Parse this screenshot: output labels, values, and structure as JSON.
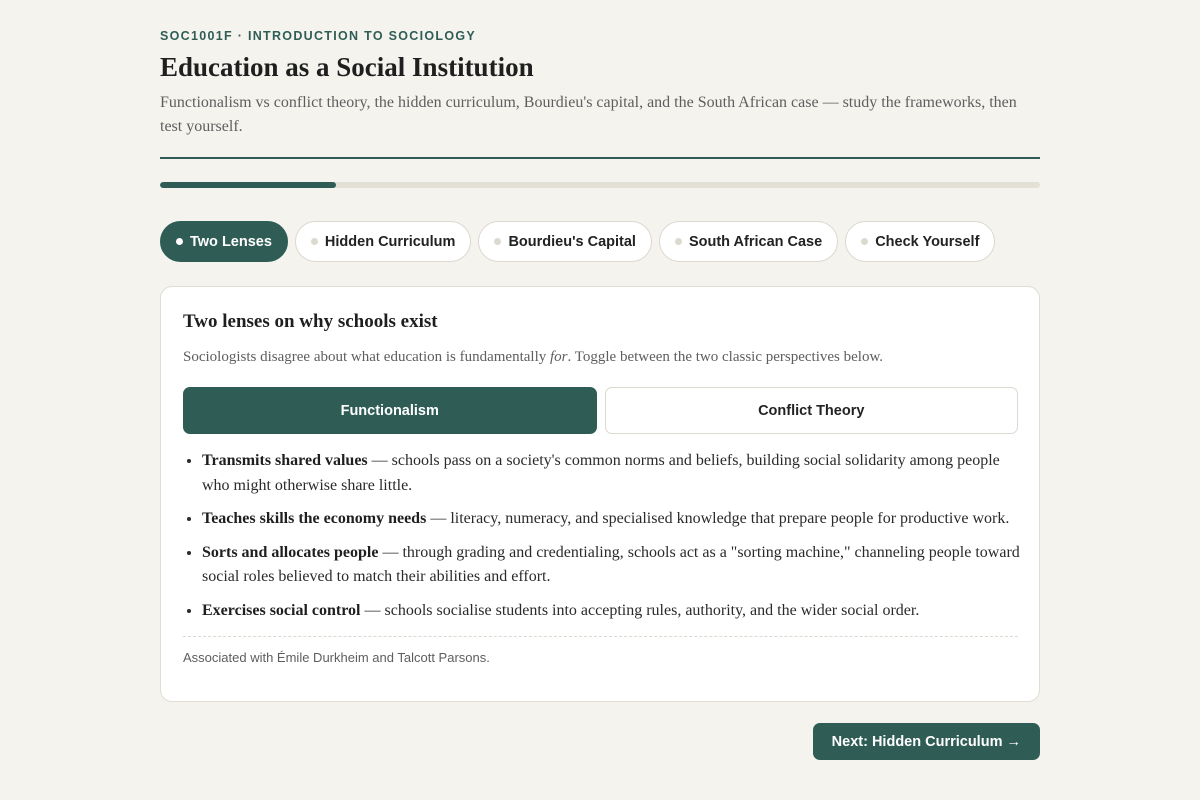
{
  "course": {
    "label": "SOC1001F · INTRODUCTION TO SOCIOLOGY"
  },
  "header": {
    "title": "Education as a Social Institution",
    "subtitle": "Functionalism vs conflict theory, the hidden curriculum, Bourdieu's capital, and the South African case — study the frameworks, then test yourself."
  },
  "progress": {
    "fraction": 0.2
  },
  "tabs": [
    {
      "label": "Two Lenses",
      "active": true
    },
    {
      "label": "Hidden Curriculum",
      "active": false
    },
    {
      "label": "Bourdieu's Capital",
      "active": false
    },
    {
      "label": "South African Case",
      "active": false
    },
    {
      "label": "Check Yourself",
      "active": false
    }
  ],
  "card": {
    "title": "Two lenses on why schools exist",
    "intro_before": "Sociologists disagree about what education is fundamentally ",
    "intro_em": "for",
    "intro_after": ". Toggle between the two classic perspectives below.",
    "toggle": [
      {
        "label": "Functionalism",
        "active": true
      },
      {
        "label": "Conflict Theory",
        "active": false
      }
    ],
    "points": [
      {
        "term": "Transmits shared values",
        "text": " — schools pass on a society's common norms and beliefs, building social solidarity among people who might otherwise share little."
      },
      {
        "term": "Teaches skills the economy needs",
        "text": " — literacy, numeracy, and specialised knowledge that prepare people for productive work."
      },
      {
        "term": "Sorts and allocates people",
        "text": " — through grading and credentialing, schools act as a \"sorting machine,\" channeling people toward social roles believed to match their abilities and effort."
      },
      {
        "term": "Exercises social control",
        "text": " — schools socialise students into accepting rules, authority, and the wider social order."
      }
    ],
    "associated": "Associated with Émile Durkheim and Talcott Parsons."
  },
  "next_button": {
    "label": "Next: Hidden Curriculum →"
  },
  "colors": {
    "accent": "#2f5d56",
    "background": "#f4f3ee",
    "track": "#e3e0d5"
  }
}
